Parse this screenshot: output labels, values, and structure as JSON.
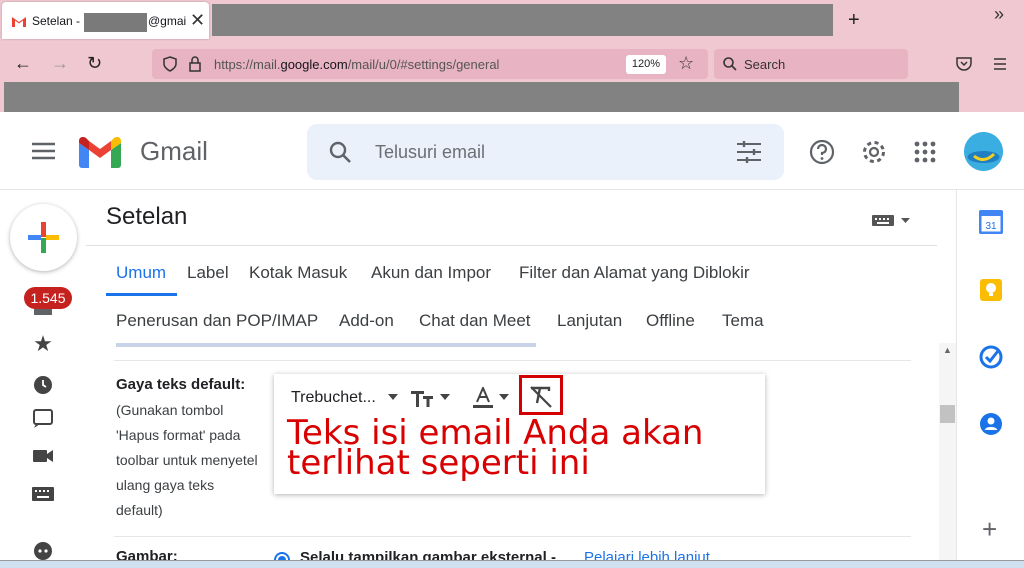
{
  "browser": {
    "tab_title": "Setelan - ",
    "tab_suffix": "@gmail",
    "url_host_prefix": "https://mail.",
    "url_host": "google.com",
    "url_path": "/mail/u/0/#settings/general",
    "zoom": "120%",
    "search_label": "Search"
  },
  "gmail": {
    "logo_text": "Gmail",
    "search_placeholder": "Telusuri email",
    "unread_count": "1.545"
  },
  "settings": {
    "title": "Setelan",
    "tabs_row1": [
      "Umum",
      "Label",
      "Kotak Masuk",
      "Akun dan Impor",
      "Filter dan Alamat yang Diblokir"
    ],
    "tabs_row2": [
      "Penerusan dan POP/IMAP",
      "Add-on",
      "Chat dan Meet",
      "Lanjutan",
      "Offline",
      "Tema"
    ],
    "default_text": {
      "label": "Gaya teks default:",
      "desc_lines": [
        "(Gunakan tombol",
        "'Hapus format' pada",
        "toolbar untuk menyetel",
        "ulang gaya teks",
        "default)"
      ],
      "font": "Trebuchet...",
      "preview_line1": "Teks isi email Anda akan",
      "preview_line2": "terlihat seperti ini"
    },
    "images": {
      "label": "Gambar:",
      "option": "Selalu tampilkan gambar eksternal",
      "separator": " - ",
      "link": "Pelajari lebih lanjut"
    }
  },
  "colors": {
    "accent": "#1a73e8",
    "highlight": "#d20000",
    "badge": "#c5221f"
  }
}
